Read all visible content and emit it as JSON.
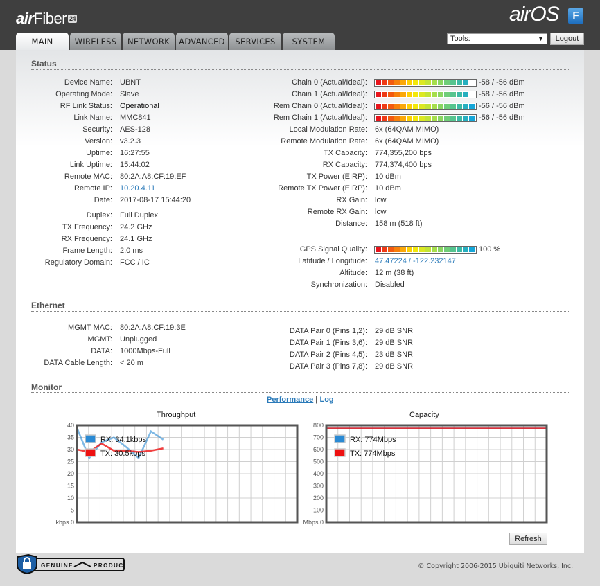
{
  "header": {
    "brand_air": "air",
    "brand_fiber": "Fiber",
    "brand_badge": "24",
    "os_logo": "airOS",
    "os_badge": "F",
    "tools_select": {
      "value": "Tools:",
      "arrow": "▼"
    },
    "logout_label": "Logout"
  },
  "tabs": [
    {
      "label": "MAIN",
      "active": true
    },
    {
      "label": "WIRELESS",
      "active": false
    },
    {
      "label": "NETWORK",
      "active": false
    },
    {
      "label": "ADVANCED",
      "active": false
    },
    {
      "label": "SERVICES",
      "active": false
    },
    {
      "label": "SYSTEM",
      "active": false
    }
  ],
  "status": {
    "title": "Status",
    "left": [
      {
        "label": "Device Name:",
        "value": "UBNT"
      },
      {
        "label": "Operating Mode:",
        "value": "Slave"
      },
      {
        "label": "RF Link Status:",
        "value": "Operational"
      },
      {
        "label": "Link Name:",
        "value": "MMC841"
      },
      {
        "label": "Security:",
        "value": "AES-128"
      },
      {
        "label": "Version:",
        "value": "v3.2.3"
      },
      {
        "label": "Uptime:",
        "value": "16:27:55"
      },
      {
        "label": "Link Uptime:",
        "value": "15:44:02"
      },
      {
        "label": "Remote MAC:",
        "value": "80:2A:A8:CF:19:EF"
      },
      {
        "label": "Remote IP:",
        "value": "10.20.4.11"
      },
      {
        "label": "Date:",
        "value": "2017-08-17 15:44:20"
      },
      {
        "label": "Duplex:",
        "value": "Full Duplex"
      },
      {
        "label": "TX Frequency:",
        "value": "24.2 GHz"
      },
      {
        "label": "RX Frequency:",
        "value": "24.1 GHz"
      },
      {
        "label": "Frame Length:",
        "value": "2.0 ms"
      },
      {
        "label": "Regulatory Domain:",
        "value": "FCC / IC"
      }
    ],
    "chains": [
      {
        "label": "Chain 0 (Actual/Ideal):",
        "value": "-58 / -56 dBm",
        "fill": 0.94
      },
      {
        "label": "Chain 1 (Actual/Ideal):",
        "value": "-58 / -56 dBm",
        "fill": 0.94
      },
      {
        "label": "Rem Chain 0 (Actual/Ideal):",
        "value": "-56 / -56 dBm",
        "fill": 1.0
      },
      {
        "label": "Rem Chain 1 (Actual/Ideal):",
        "value": "-56 / -56 dBm",
        "fill": 1.0
      }
    ],
    "right": [
      {
        "label": "Local Modulation Rate:",
        "value": "6x (64QAM MIMO)"
      },
      {
        "label": "Remote Modulation Rate:",
        "value": "6x (64QAM MIMO)"
      },
      {
        "label": "TX Capacity:",
        "value": "774,355,200 bps"
      },
      {
        "label": "RX Capacity:",
        "value": "774,374,400 bps"
      },
      {
        "label": "TX Power (EIRP):",
        "value": "10 dBm"
      },
      {
        "label": "Remote TX Power (EIRP):",
        "value": "10 dBm"
      },
      {
        "label": "RX Gain:",
        "value": "low"
      },
      {
        "label": "Remote RX Gain:",
        "value": "low"
      },
      {
        "label": "Distance:",
        "value": "158 m (518 ft)"
      }
    ],
    "gps": {
      "label": "GPS Signal Quality:",
      "value": "100 %",
      "fill": 1.0
    },
    "gps_rows": [
      {
        "label": "Latitude / Longitude:",
        "value": "47.47224 / -122.232147"
      },
      {
        "label": "Altitude:",
        "value": "12 m (38 ft)"
      },
      {
        "label": "Synchronization:",
        "value": "Disabled"
      }
    ]
  },
  "ethernet": {
    "title": "Ethernet",
    "left": [
      {
        "label": "MGMT MAC:",
        "value": "80:2A:A8:CF:19:3E"
      },
      {
        "label": "MGMT:",
        "value": "Unplugged"
      },
      {
        "label": "DATA:",
        "value": "1000Mbps-Full"
      },
      {
        "label": "DATA Cable Length:",
        "value": "< 20 m"
      }
    ],
    "right": [
      {
        "label": "DATA Pair 0 (Pins 1,2):",
        "value": "29 dB SNR"
      },
      {
        "label": "DATA Pair 1 (Pins 3,6):",
        "value": "29 dB SNR"
      },
      {
        "label": "DATA Pair 2 (Pins 4,5):",
        "value": "23 dB SNR"
      },
      {
        "label": "DATA Pair 3 (Pins 7,8):",
        "value": "29 dB SNR"
      }
    ]
  },
  "monitor": {
    "title": "Monitor",
    "performance_link": "Performance",
    "separator": "|",
    "log_link": "Log",
    "refresh_label": "Refresh"
  },
  "chart_data": [
    {
      "type": "line",
      "title": "Throughput",
      "ylabel": "kbps",
      "ylim": [
        0,
        40
      ],
      "yticks": [
        "kbps 0",
        "5",
        "10",
        "15",
        "20",
        "25",
        "30",
        "35",
        "40"
      ],
      "grid": true,
      "legend": "top-left",
      "series": [
        {
          "name": "RX",
          "legend_label": "RX: 34.1kbps",
          "color": "#2a8ad4",
          "values": [
            39,
            26.5,
            33,
            35,
            31,
            26.5,
            37.5,
            34.1
          ]
        },
        {
          "name": "TX",
          "legend_label": "TX: 30.5kbps",
          "color": "#ee1111",
          "values": [
            30,
            29,
            32.5,
            29.5,
            29.5,
            29,
            29.5,
            30.5
          ]
        }
      ],
      "x_max_samples": 20
    },
    {
      "type": "line",
      "title": "Capacity",
      "ylabel": "Mbps",
      "ylim": [
        0,
        800
      ],
      "yticks": [
        "Mbps 0",
        "100",
        "200",
        "300",
        "400",
        "500",
        "600",
        "700",
        "800"
      ],
      "grid": true,
      "legend": "top-left",
      "series": [
        {
          "name": "RX",
          "legend_label": "RX: 774Mbps",
          "color": "#2a8ad4",
          "values": [
            774,
            774
          ]
        },
        {
          "name": "TX",
          "legend_label": "TX: 774Mbps",
          "color": "#ee1111",
          "values": [
            774,
            774
          ]
        }
      ],
      "x_max_samples": 2
    }
  ],
  "footer": {
    "genuine_left": "GENUINE",
    "genuine_right": "PRODUCT",
    "copyright": "© Copyright 2006-2015 Ubiquiti Networks, Inc."
  }
}
